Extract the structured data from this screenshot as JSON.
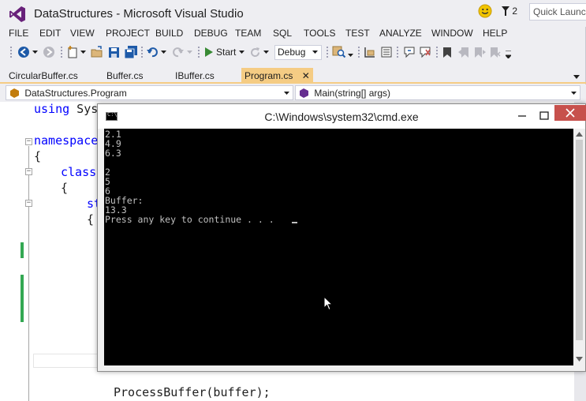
{
  "titlebar": {
    "title": "DataStructures - Microsoft Visual Studio",
    "notification_count": "2",
    "quick_launch_placeholder": "Quick Launch"
  },
  "menu": [
    "FILE",
    "EDIT",
    "VIEW",
    "PROJECT",
    "BUILD",
    "DEBUG",
    "TEAM",
    "SQL",
    "TOOLS",
    "TEST",
    "ANALYZE",
    "WINDOW",
    "HELP"
  ],
  "toolbar": {
    "start_label": "Start",
    "configuration": "Debug"
  },
  "tabs": [
    {
      "label": "CircularBuffer.cs",
      "active": false
    },
    {
      "label": "Buffer.cs",
      "active": false
    },
    {
      "label": "IBuffer.cs",
      "active": false
    },
    {
      "label": "Program.cs",
      "active": true
    }
  ],
  "navbar": {
    "class_dropdown": "DataStructures.Program",
    "member_dropdown": "Main(string[] args)"
  },
  "editor": {
    "lines": {
      "using_kw": "using",
      "using_rest": " Syst",
      "namespace_kw": "namespace",
      "open1": "{",
      "class_kw": "class",
      "open2": "{",
      "st_kw": "st",
      "open3": "{",
      "call": "ProcessBuffer(buffer);"
    }
  },
  "cmd": {
    "title": "C:\\Windows\\system32\\cmd.exe",
    "icon_text": "C:\\",
    "output": [
      "2.1",
      "4.9",
      "6.3",
      "",
      "2",
      "5",
      "6",
      "Buffer:",
      "13.3",
      "Press any key to continue . . . "
    ]
  },
  "colors": {
    "accent_tab": "#f5cc84",
    "keyword": "#0000ff",
    "change_bar": "#34a853",
    "close_button": "#c7514c"
  }
}
